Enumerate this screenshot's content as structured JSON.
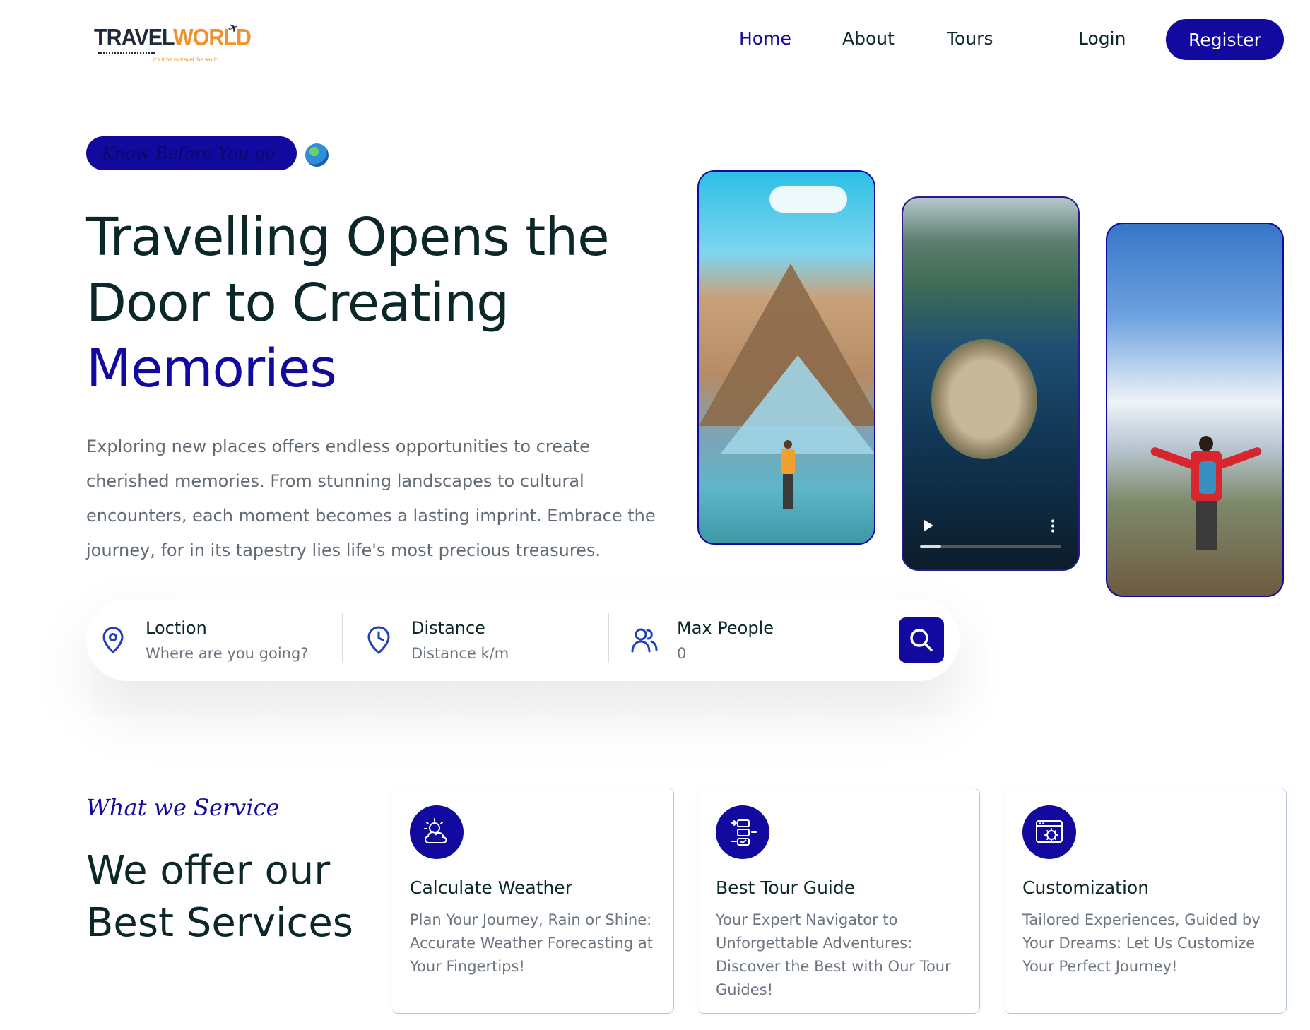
{
  "logo": {
    "word_travel": "TRAVEL",
    "word_world": "WORLD",
    "tagline": "it's time to travel the world"
  },
  "nav": {
    "home": "Home",
    "about": "About",
    "tours": "Tours",
    "login": "Login",
    "register": "Register"
  },
  "hero": {
    "badge": "Know Before You go",
    "title_line1": "Travelling Opens the",
    "title_line2": "Door to Creating",
    "title_accent": "Memories",
    "description": "Exploring new places offers endless opportunities to create cherished memories. From stunning landscapes to cultural encounters, each moment becomes a lasting imprint. Embrace the journey, for in its tapestry lies life's most precious treasures."
  },
  "search": {
    "location_label": "Loction",
    "location_placeholder": "Where are you going?",
    "distance_label": "Distance",
    "distance_placeholder": "Distance k/m",
    "people_label": "Max People",
    "people_value": "0"
  },
  "services": {
    "subtitle": "What we Service",
    "title_line1": "We offer our",
    "title_line2": "Best Services",
    "cards": [
      {
        "title": "Calculate Weather",
        "description": "Plan Your Journey, Rain or Shine: Accurate Weather Forecasting at Your Fingertips!",
        "icon": "weather-icon"
      },
      {
        "title": "Best Tour Guide",
        "description": "Your Expert Navigator to Unforgettable Adventures: Discover the Best with Our Tour Guides!",
        "icon": "guide-icon"
      },
      {
        "title": "Customization",
        "description": "Tailored Experiences, Guided by Your Dreams: Let Us Customize Your Perfect Journey!",
        "icon": "customize-icon"
      }
    ]
  },
  "colors": {
    "primary": "#12099e",
    "heading": "#0b2727",
    "text_muted": "#6b7580",
    "logo_orange": "#f0922b"
  }
}
